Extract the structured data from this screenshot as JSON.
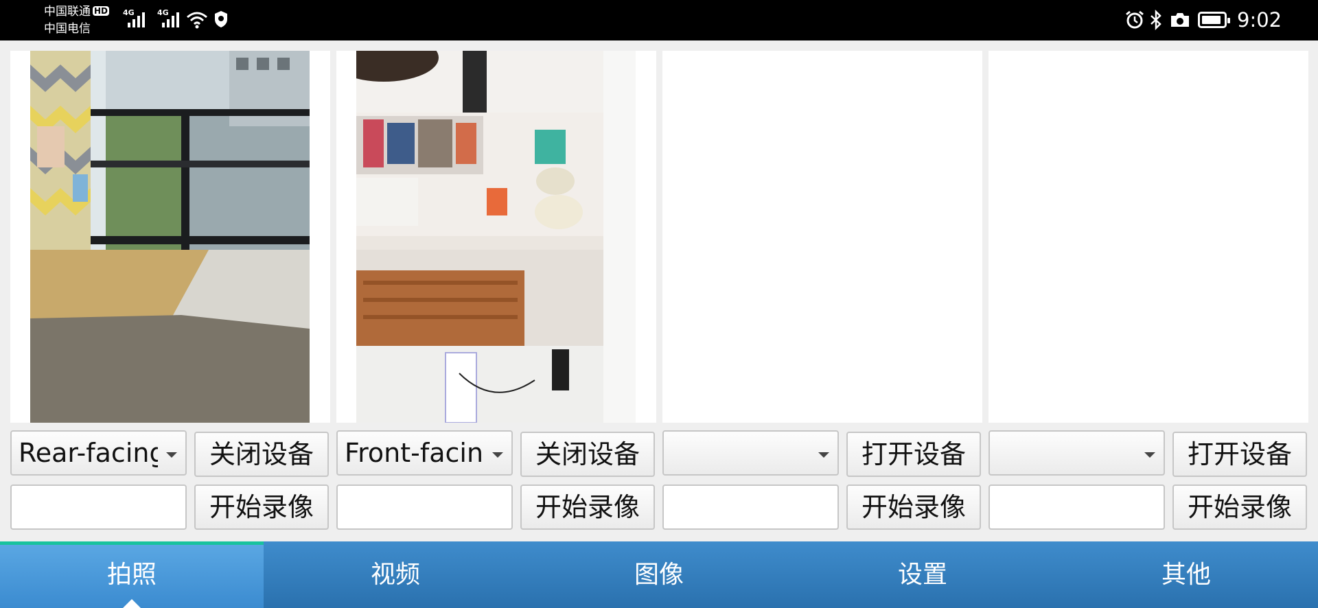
{
  "status_bar": {
    "carrier_1": "中国联通",
    "carrier_1_badge": "HD",
    "carrier_2": "中国电信",
    "network_1": "4G",
    "network_2": "4G",
    "icons": [
      "signal-icon",
      "signal-icon",
      "wifi-icon",
      "shield-icon",
      "alarm-icon",
      "bluetooth-icon",
      "camera-icon",
      "battery-icon"
    ],
    "battery_level": 0.9,
    "time": "9:02"
  },
  "panels": [
    {
      "camera_select": "Rear-facing c",
      "device_button": "关闭设备",
      "record_button": "开始录像",
      "record_field": "",
      "has_preview": true
    },
    {
      "camera_select": "Front-facing",
      "device_button": "关闭设备",
      "record_button": "开始录像",
      "record_field": "",
      "has_preview": true
    },
    {
      "camera_select": "",
      "device_button": "打开设备",
      "record_button": "开始录像",
      "record_field": "",
      "has_preview": false
    },
    {
      "camera_select": "",
      "device_button": "打开设备",
      "record_button": "开始录像",
      "record_field": "",
      "has_preview": false
    }
  ],
  "bottom_nav": {
    "tabs": [
      {
        "label": "拍照",
        "active": true
      },
      {
        "label": "视频",
        "active": false
      },
      {
        "label": "图像",
        "active": false
      },
      {
        "label": "设置",
        "active": false
      },
      {
        "label": "其他",
        "active": false
      }
    ]
  },
  "colors": {
    "nav_top": "#3f8ccc",
    "nav_bottom": "#2a71ae",
    "active_indicator": "#19c29e",
    "status_bar": "#000000"
  }
}
